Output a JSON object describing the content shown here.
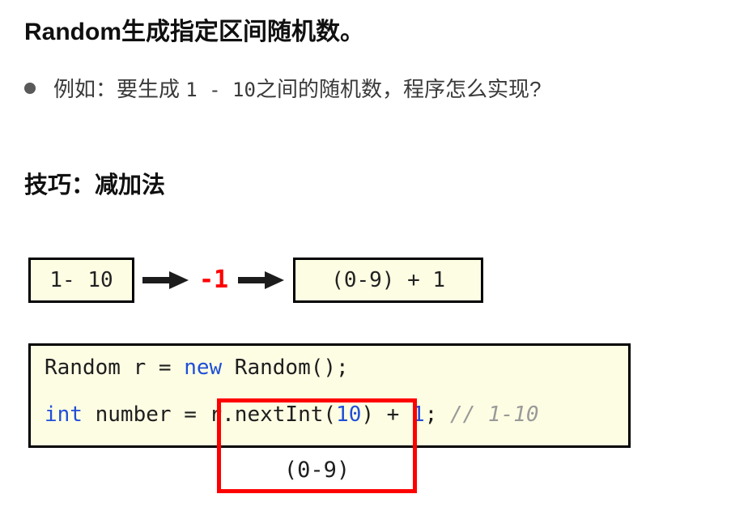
{
  "slide": {
    "title": "Random生成指定区间随机数。",
    "bullet": {
      "icon": "bullet-dot",
      "text_before": "例如：要生成 ",
      "range": "1 - 10",
      "text_after": "之间的随机数，程序怎么实现?"
    },
    "section_heading": "技巧：减加法",
    "flow": {
      "box1": "1- 10",
      "arrow1": "right-arrow",
      "operator": "-1",
      "arrow2": "right-arrow",
      "box2": "(0-9) + 1"
    },
    "code": {
      "line1": {
        "part1": "Random r = ",
        "keyword": "new",
        "part2": " Random();"
      },
      "line2": {
        "keyword1": "int",
        "part1": " number = r.nextInt(",
        "num1": "10",
        "part2": ") + ",
        "num2": "1",
        "part3": "; ",
        "comment": "// 1-10"
      }
    },
    "annotation": {
      "range_note": "(0-9)",
      "highlight": "red-highlight-box"
    }
  },
  "colors": {
    "box_fill": "#FDFDE3",
    "box_border": "#000000",
    "keyword_blue": "#1F4FD8",
    "accent_red": "#FF0000",
    "comment_gray": "#9A9A9A",
    "title_black": "#101010",
    "bullet_gray": "#595959"
  }
}
